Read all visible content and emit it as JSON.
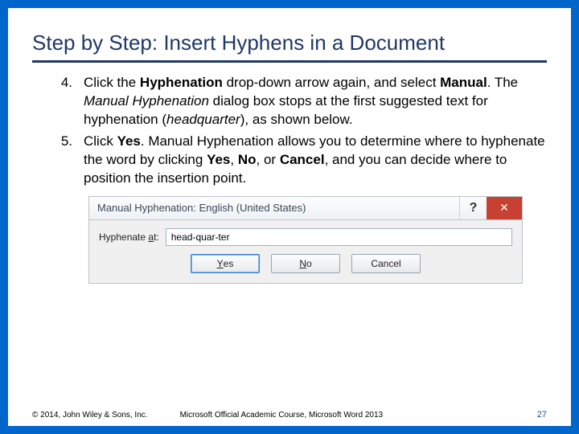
{
  "title": "Step by Step: Insert Hyphens in a Document",
  "items": [
    {
      "num": "4.",
      "parts": [
        {
          "t": "Click the "
        },
        {
          "t": "Hyphenation",
          "b": true
        },
        {
          "t": " drop-down arrow again, and select "
        },
        {
          "t": "Manual",
          "b": true
        },
        {
          "t": ". The "
        },
        {
          "t": "Manual Hyphenation",
          "i": true
        },
        {
          "t": " dialog box stops at the first suggested text for hyphenation ("
        },
        {
          "t": "headquarter",
          "i": true
        },
        {
          "t": "), as shown below."
        }
      ]
    },
    {
      "num": "5.",
      "parts": [
        {
          "t": "Click "
        },
        {
          "t": "Yes",
          "b": true
        },
        {
          "t": ". Manual Hyphenation allows you to determine where to hyphenate the word by clicking "
        },
        {
          "t": "Yes",
          "b": true
        },
        {
          "t": ", "
        },
        {
          "t": "No",
          "b": true
        },
        {
          "t": ", or "
        },
        {
          "t": "Cancel",
          "b": true
        },
        {
          "t": ", and you can decide where to position the insertion point."
        }
      ]
    }
  ],
  "dialog": {
    "title": "Manual Hyphenation: English (United States)",
    "help": "?",
    "close": "✕",
    "label_pre": "Hyphenate ",
    "label_u": "a",
    "label_post": "t:",
    "input_value": "head-quar-ter",
    "yes_u": "Y",
    "yes_post": "es",
    "no_u": "N",
    "no_post": "o",
    "cancel": "Cancel"
  },
  "footer": {
    "left": "© 2014, John Wiley & Sons, Inc.",
    "center": "Microsoft Official Academic Course, Microsoft Word 2013",
    "right": "27"
  }
}
